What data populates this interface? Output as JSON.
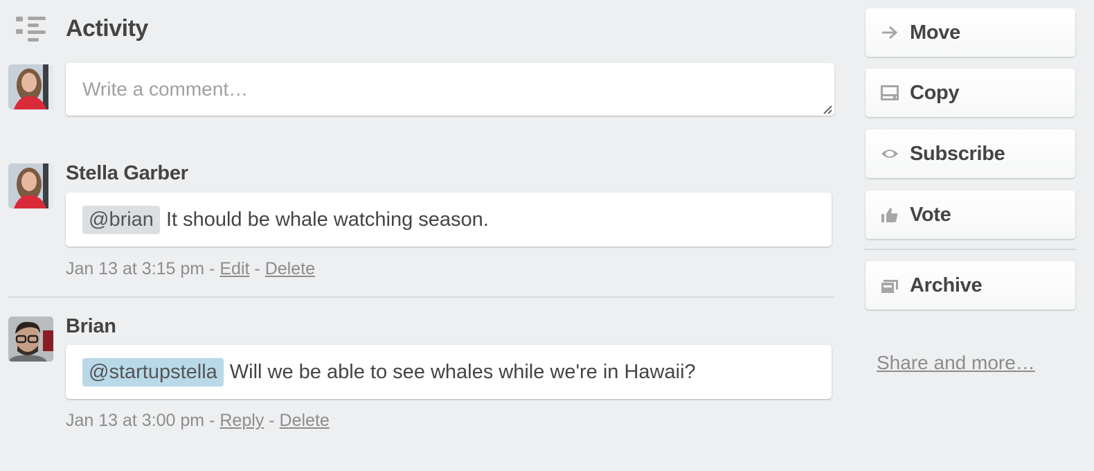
{
  "section": {
    "title": "Activity",
    "icon": "activity-list-icon"
  },
  "composer": {
    "placeholder": "Write a comment…",
    "value": "",
    "avatar_alt": "Stella Garber avatar"
  },
  "comments": [
    {
      "author": "Stella Garber",
      "mention": "@brian",
      "text": "It should be whale watching season.",
      "timestamp": "Jan 13 at 3:15 pm",
      "separator": "-",
      "actions": [
        "Edit",
        "Delete"
      ],
      "mention_color": "#dcdfe2"
    },
    {
      "author": "Brian",
      "mention": "@startupstella",
      "text": "Will we be able to see whales while we're in Hawaii?",
      "timestamp": "Jan 13 at 3:00 pm",
      "separator": "-",
      "actions": [
        "Reply",
        "Delete"
      ],
      "mention_color": "#b9d9e9"
    }
  ],
  "sidebar": {
    "buttons": [
      {
        "label": "Move",
        "icon": "arrow-right-icon"
      },
      {
        "label": "Copy",
        "icon": "copy-card-icon"
      },
      {
        "label": "Subscribe",
        "icon": "eye-icon"
      },
      {
        "label": "Vote",
        "icon": "thumbs-up-icon"
      },
      {
        "label": "Archive",
        "icon": "archive-icon"
      }
    ],
    "share_link": "Share and more…"
  },
  "colors": {
    "background": "#edeff1",
    "text": "#444444",
    "muted": "#8c8c8c",
    "icon": "#a6a6a6"
  }
}
